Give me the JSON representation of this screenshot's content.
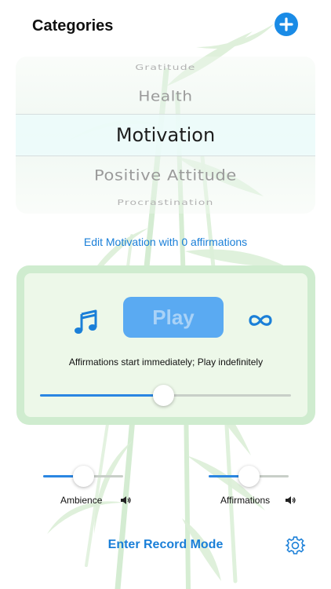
{
  "header": {
    "title": "Categories",
    "add_icon": "plus-circle-icon"
  },
  "picker": {
    "items": [
      "Gratitude",
      "Health",
      "Motivation",
      "Positive Attitude",
      "Procrastination"
    ],
    "selected": "Motivation"
  },
  "edit_link": "Edit Motivation with 0 affirmations",
  "player": {
    "music_icon": "music-note-icon",
    "play_label": "Play",
    "loop_icon": "infinity-icon",
    "description": "Affirmations start immediately; Play indefinitely",
    "delay_slider_value": 0.49
  },
  "mix": {
    "ambience": {
      "label": "Ambience",
      "value": 0.5,
      "icon": "speaker-icon"
    },
    "affirmations": {
      "label": "Affirmations",
      "value": 0.5,
      "icon": "speaker-icon"
    }
  },
  "record_mode_label": "Enter Record Mode",
  "settings_icon": "gear-icon",
  "colors": {
    "accent": "#1a8be6",
    "link": "#1a7fd8",
    "play_button": "#5aaaf2",
    "panel": "#cfeccf"
  }
}
